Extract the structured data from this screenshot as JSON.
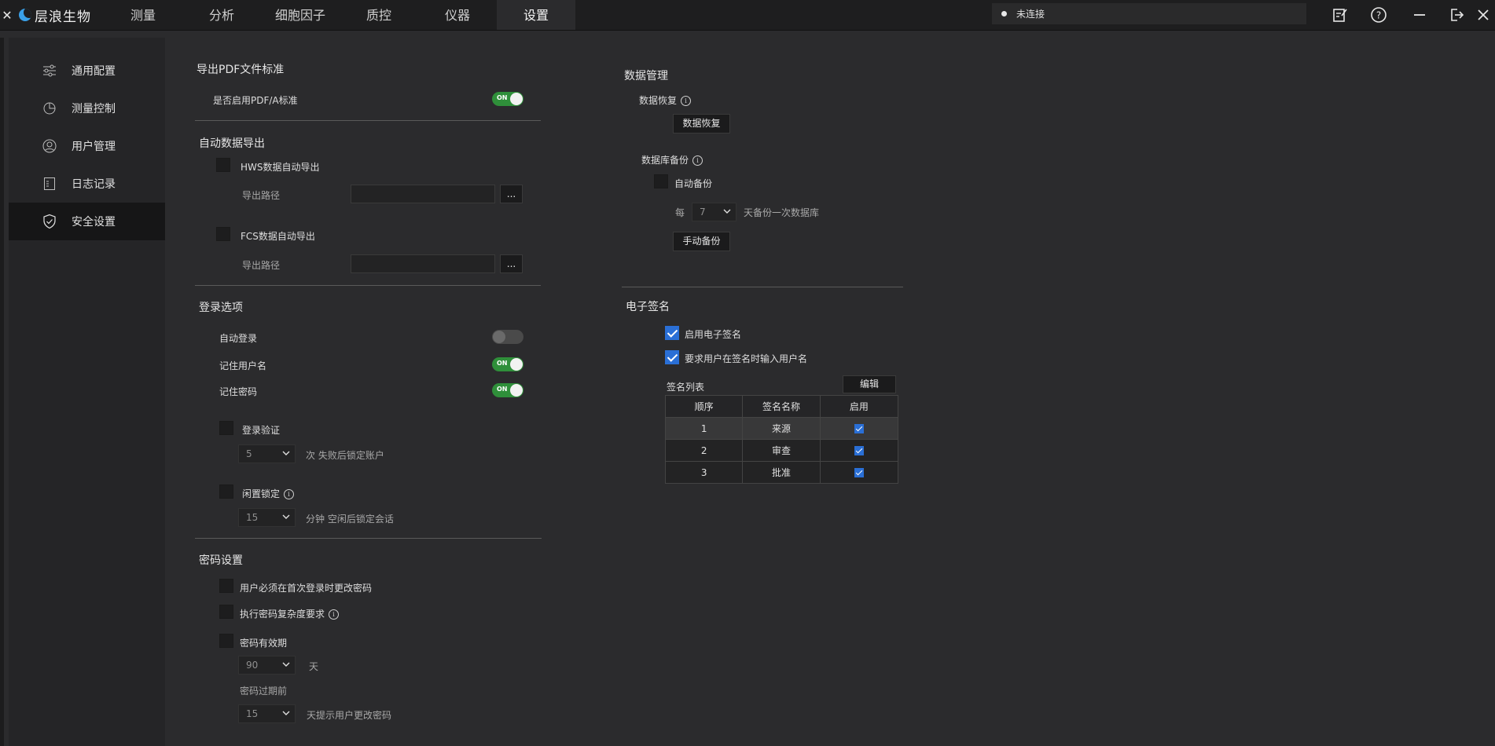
{
  "app": {
    "brand": "层浪生物",
    "back_glyph": "✕"
  },
  "nav": {
    "tabs": [
      {
        "label": "测量",
        "active": false
      },
      {
        "label": "分析",
        "active": false
      },
      {
        "label": "细胞因子",
        "active": false
      },
      {
        "label": "质控",
        "active": false
      },
      {
        "label": "仪器",
        "active": false
      },
      {
        "label": "设置",
        "active": true
      }
    ]
  },
  "status": {
    "connection": "未连接"
  },
  "top_icons": [
    "notes-icon",
    "help-icon",
    "minimize-icon",
    "logout-icon",
    "close-icon"
  ],
  "sidebar": {
    "items": [
      {
        "label": "通用配置",
        "icon": "sliders-icon"
      },
      {
        "label": "测量控制",
        "icon": "pie-chart-icon"
      },
      {
        "label": "用户管理",
        "icon": "user-icon"
      },
      {
        "label": "日志记录",
        "icon": "log-icon"
      },
      {
        "label": "安全设置",
        "icon": "shield-icon",
        "active": true
      }
    ]
  },
  "pdf": {
    "title": "导出PDF文件标准",
    "enable_label": "是否启用PDF/A标准",
    "enabled": true,
    "on_text": "ON"
  },
  "auto_export": {
    "title": "自动数据导出",
    "hws_label": "HWS数据自动导出",
    "fcs_label": "FCS数据自动导出",
    "path_label": "导出路径",
    "browse": "..."
  },
  "login": {
    "title": "登录选项",
    "auto_login": "自动登录",
    "remember_user": "记住用户名",
    "remember_pwd": "记住密码",
    "verify": "登录验证",
    "fail_count": "5",
    "fail_suffix": "次 失败后锁定账户",
    "idle_lock": "闲置锁定",
    "idle_minutes": "15",
    "idle_suffix": "分钟 空闲后锁定会话"
  },
  "password": {
    "title": "密码设置",
    "must_change": "用户必须在首次登录时更改密码",
    "complexity": "执行密码复杂度要求",
    "validity": "密码有效期",
    "validity_days": "90",
    "days_unit": "天",
    "before_expire": "密码过期前",
    "remind_days": "15",
    "remind_suffix": "天提示用户更改密码"
  },
  "data_mgmt": {
    "title": "数据管理",
    "recover_label": "数据恢复",
    "recover_btn": "数据恢复",
    "backup_label": "数据库备份",
    "auto_backup": "自动备份",
    "every": "每",
    "interval": "7",
    "interval_suffix": "天备份一次数据库",
    "manual_btn": "手动备份"
  },
  "esign": {
    "title": "电子签名",
    "enable": "启用电子签名",
    "require_user": "要求用户在签名时输入用户名",
    "list_label": "签名列表",
    "edit_btn": "编辑",
    "headers": [
      "顺序",
      "签名名称",
      "启用"
    ],
    "rows": [
      {
        "order": "1",
        "name": "来源",
        "enabled": true
      },
      {
        "order": "2",
        "name": "审查",
        "enabled": true
      },
      {
        "order": "3",
        "name": "批准",
        "enabled": true
      }
    ]
  },
  "colors": {
    "accent": "#2a6fd6",
    "toggle_on": "#2f8f3a",
    "bg": "#2b2b2d"
  }
}
